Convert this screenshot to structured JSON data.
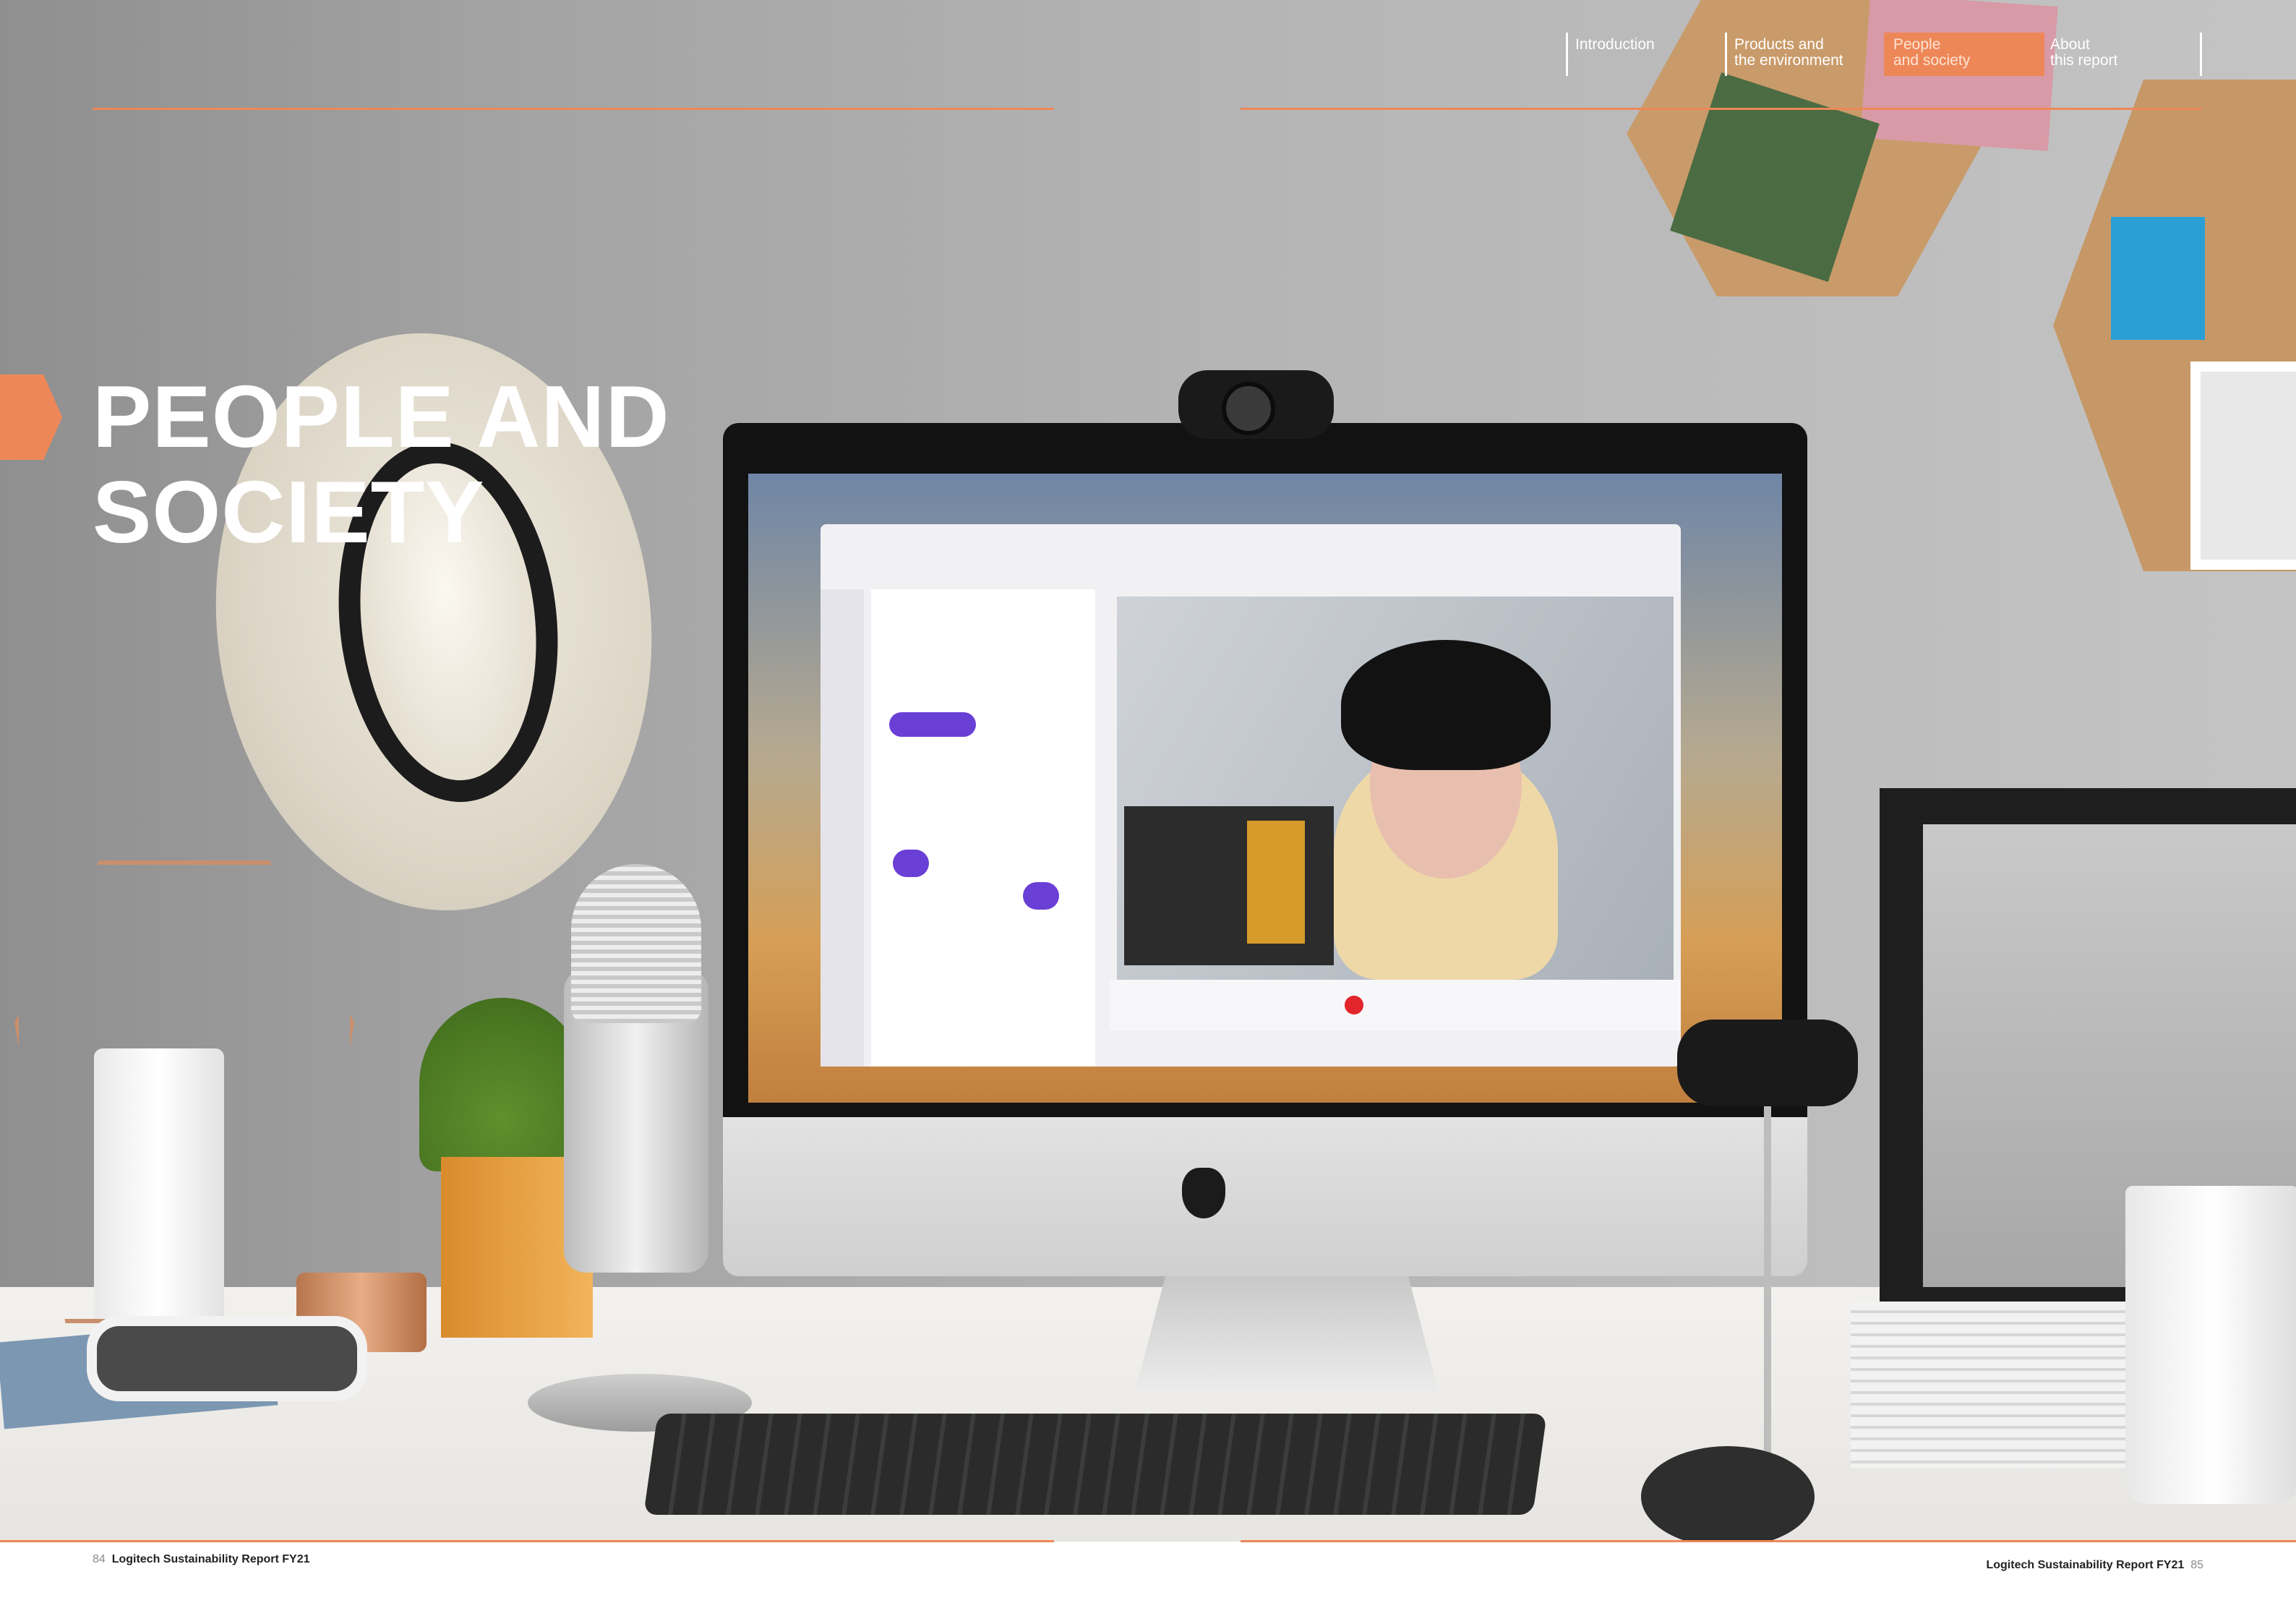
{
  "nav": {
    "introduction": [
      "Introduction"
    ],
    "products": [
      "Products and",
      "the environment"
    ],
    "people": [
      "People",
      "and society"
    ],
    "about": [
      "About",
      "this report"
    ]
  },
  "title": {
    "line1": "PEOPLE AND",
    "line2": "SOCIETY"
  },
  "footer": {
    "left_page": "84",
    "left_title": "Logitech Sustainability Report FY21",
    "right_title": "Logitech Sustainability Report FY21",
    "right_page": "85"
  },
  "colors": {
    "accent": "#ee8758",
    "title_text": "#ffffff"
  },
  "icons": {
    "section_marker": "arrow-chevron-icon"
  }
}
